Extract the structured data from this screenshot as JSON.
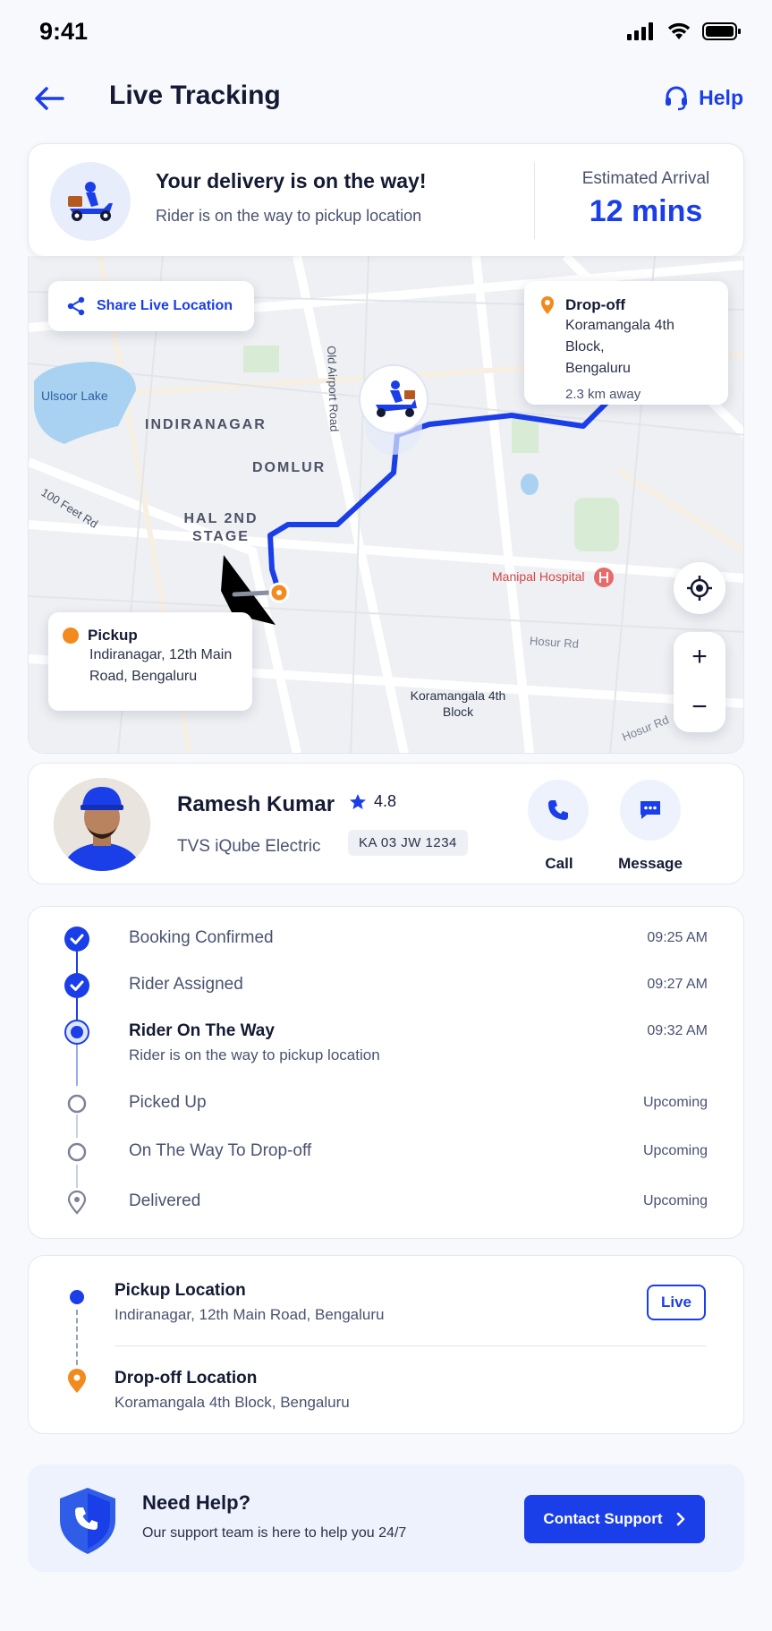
{
  "status_bar": {
    "time": "9:41"
  },
  "header": {
    "title": "Live Tracking",
    "help_label": "Help"
  },
  "status_card": {
    "title": "Your delivery is on the way!",
    "subtitle": "Rider is on the way to pickup location",
    "eta_label": "Estimated Arrival",
    "eta_value": "12 mins"
  },
  "map": {
    "share_label": "Share Live Location",
    "labels": {
      "lake": "Ulsoor Lake",
      "indiranagar": "INDIRANAGAR",
      "domlur": "DOMLUR",
      "hal": "HAL 2ND STAGE",
      "road_100ft": "100 Feet Rd",
      "old_airport": "Old Airport Road",
      "hospital": "Manipal Hospital",
      "hosur1": "Hosur Rd",
      "hosur2": "Hosur Rd",
      "koramangala": "Koramangala 4th Block"
    },
    "dropoff": {
      "title": "Drop-off",
      "line1": "Koramangala 4th Block,",
      "line2": "Bengaluru",
      "distance": "2.3 km away"
    },
    "pickup": {
      "title": "Pickup",
      "line1": "Indiranagar, 12th Main",
      "line2": "Road, Bengaluru"
    },
    "zoom_in": "+",
    "zoom_out": "−"
  },
  "rider": {
    "name": "Ramesh Kumar",
    "rating": "4.8",
    "vehicle": "TVS iQube Electric",
    "plate": "KA 03 JW 1234",
    "call_label": "Call",
    "message_label": "Message"
  },
  "timeline": [
    {
      "label": "Booking Confirmed",
      "time": "09:25 AM",
      "state": "done"
    },
    {
      "label": "Rider Assigned",
      "time": "09:27 AM",
      "state": "done"
    },
    {
      "label": "Rider On The Way",
      "sub": "Rider is on the way to pickup location",
      "time": "09:32 AM",
      "state": "active"
    },
    {
      "label": "Picked Up",
      "time": "Upcoming",
      "state": "upcoming"
    },
    {
      "label": "On The Way To Drop-off",
      "time": "Upcoming",
      "state": "upcoming"
    },
    {
      "label": "Delivered",
      "time": "Upcoming",
      "state": "upcoming-pin"
    }
  ],
  "locations": {
    "pickup_title": "Pickup Location",
    "pickup_addr": "Indiranagar, 12th Main Road, Bengaluru",
    "live_label": "Live",
    "dropoff_title": "Drop-off Location",
    "dropoff_addr": "Koramangala 4th Block, Bengaluru"
  },
  "help_card": {
    "title": "Need Help?",
    "subtitle": "Our support team is here to help you 24/7",
    "button_label": "Contact Support"
  },
  "colors": {
    "accent": "#1a3ee8",
    "orange": "#f28a1e",
    "text": "#141a33",
    "muted": "#4a5270"
  }
}
